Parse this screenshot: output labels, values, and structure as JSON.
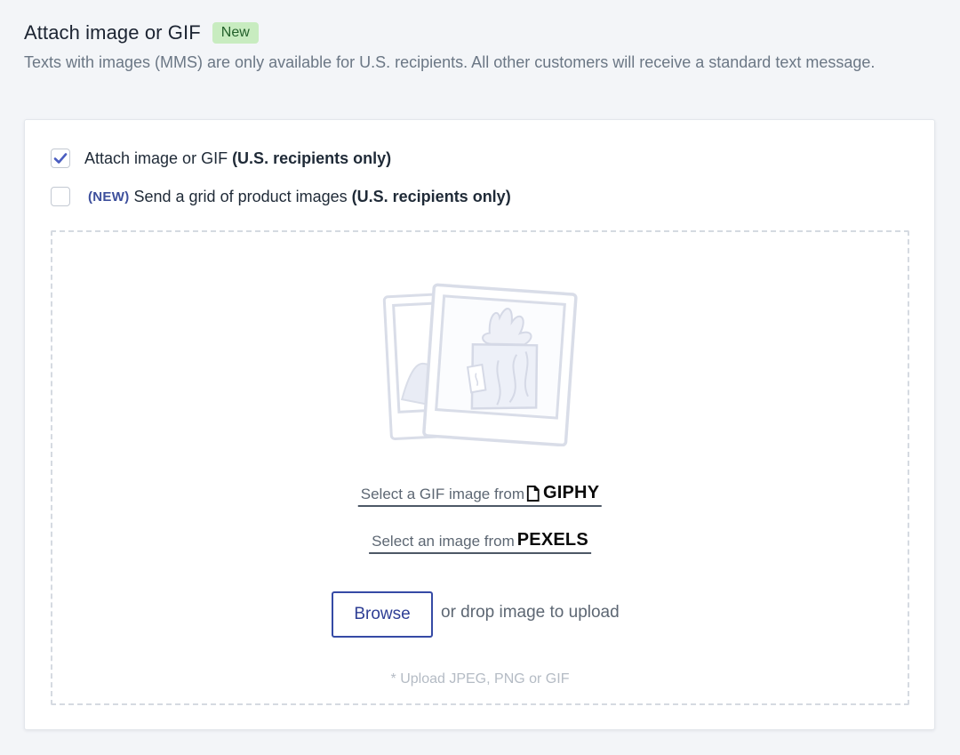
{
  "header": {
    "title": "Attach image or GIF",
    "badge": "New",
    "description": "Texts with images (MMS) are only available for U.S. recipients. All other customers will receive a standard text message."
  },
  "options": {
    "attach": {
      "label": "Attach image or GIF",
      "qualifier": "(U.S. recipients only)",
      "checked": true
    },
    "grid": {
      "tag": "(NEW)",
      "label": "Send a grid of product images",
      "qualifier": "(U.S. recipients only)",
      "checked": false
    }
  },
  "upload": {
    "illustration": "photos-illustration",
    "giphy_link": "Select a GIF image from",
    "giphy_brand": "GIPHY",
    "pexels_link": "Select an image from",
    "pexels_brand": "PEXELS",
    "browse_label": "Browse",
    "drop_text": "or drop image to upload",
    "hint": "* Upload JPEG, PNG or GIF"
  },
  "colors": {
    "accent": "#354aa5",
    "checkmark": "#4a5dc0",
    "badge_bg": "#c8ecc0",
    "badge_text": "#23602b"
  }
}
